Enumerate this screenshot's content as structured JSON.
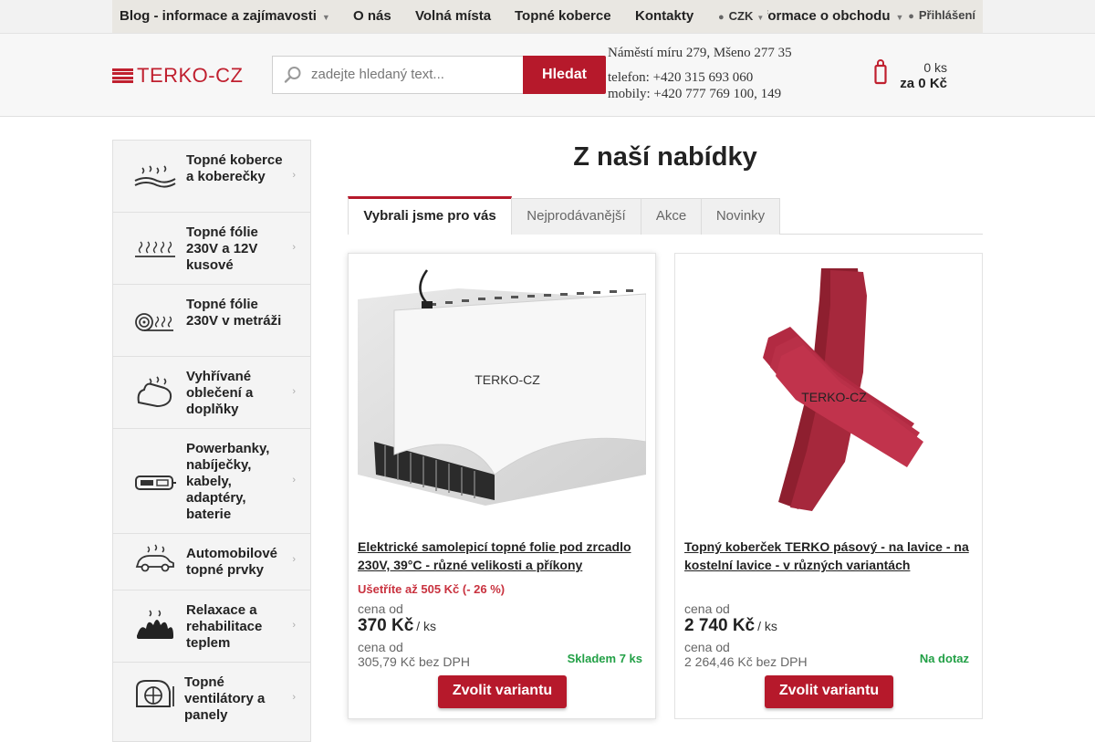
{
  "topnav": {
    "items": [
      {
        "label": "Blog - informace a zajímavosti"
      },
      {
        "label": "O nás"
      },
      {
        "label": "Volná místa"
      },
      {
        "label": "Topné koberce"
      },
      {
        "label": "Kontakty"
      },
      {
        "label": "Informace o obchodu"
      }
    ],
    "currency": "CZK",
    "login": "Přihlášení"
  },
  "header": {
    "logo_text": "TERKO-CZ",
    "search_placeholder": "zadejte hledaný text...",
    "search_button": "Hledat",
    "address": "Náměstí míru 279, Mšeno 277 35",
    "phone": "telefon: +420 315 693 060",
    "mobile": "mobily: +420 777 769 100, 149",
    "cart_count": "0 ks",
    "cart_total": "za 0 Kč"
  },
  "sidebar": {
    "categories": [
      {
        "label": "Topné koberce a koberečky",
        "icon": "heating-carpet-icon"
      },
      {
        "label": "Topné fólie 230V a 12V kusové",
        "icon": "heating-foil-icon"
      },
      {
        "label": "Topné fólie 230V v metráži",
        "icon": "foil-roll-icon"
      },
      {
        "label": "Vyhřívané oblečení a doplňky",
        "icon": "heated-glove-icon"
      },
      {
        "label": "Powerbanky, nabíječky, kabely, adaptéry, baterie",
        "icon": "powerbank-icon"
      },
      {
        "label": "Automobilové topné prvky",
        "icon": "car-heating-icon"
      },
      {
        "label": "Relaxace a rehabilitace teplem",
        "icon": "relax-heat-icon"
      },
      {
        "label": "Topné ventilátory a panely",
        "icon": "fan-heater-icon"
      }
    ]
  },
  "main": {
    "title": "Z naší nabídky",
    "tabs": [
      {
        "label": "Vybrali jsme pro vás"
      },
      {
        "label": "Nejprodávanější"
      },
      {
        "label": "Akce"
      },
      {
        "label": "Novinky"
      }
    ],
    "products": [
      {
        "name": "Elektrické samolepicí topné folie pod zrcadlo 230V, 39°C - různé velikosti a příkony",
        "saving": "Ušetříte až 505 Kč  (- 26 %)",
        "price_label": "cena od",
        "price": "370 Kč",
        "unit": "/ ks",
        "net_label": "cena od",
        "net_price": "305,79 Kč bez DPH",
        "stock": "Skladem 7 ks",
        "button": "Zvolit variantu",
        "image_text": "TERKO-CZ"
      },
      {
        "name": "Topný koberček TERKO pásový - na lavice - na kostelní lavice - v různých variantách",
        "saving": "",
        "price_label": "cena od",
        "price": "2 740 Kč",
        "unit": "/ ks",
        "net_label": "cena od",
        "net_price": "2 264,46 Kč bez DPH",
        "stock": "Na dotaz",
        "button": "Zvolit variantu",
        "image_text": "TERKO-CZ"
      }
    ]
  },
  "colors": {
    "brand": "#b6192b",
    "stock": "#22a046",
    "saving": "#c9323f"
  }
}
